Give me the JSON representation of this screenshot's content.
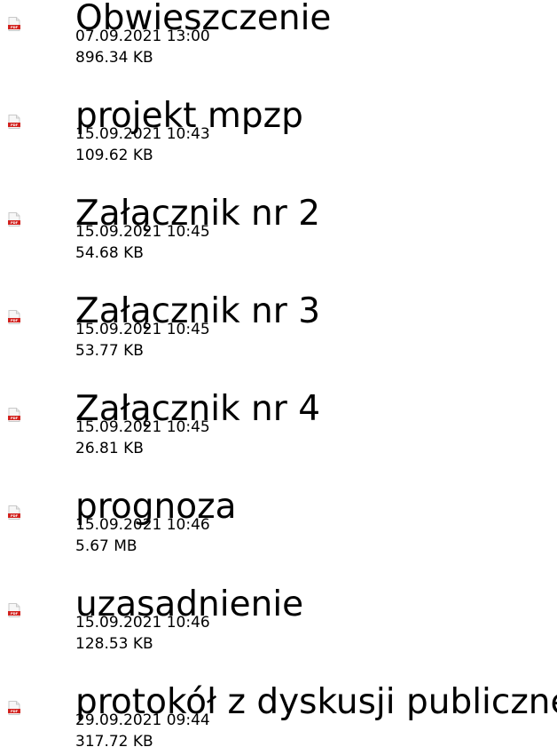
{
  "files": [
    {
      "name": "Obwieszczenie",
      "date": "07.09.2021 13:00",
      "size": "896.34 KB",
      "icon": "pdf-file-icon",
      "icon_label": "PDF"
    },
    {
      "name": "projekt mpzp",
      "date": "15.09.2021 10:43",
      "size": "109.62 KB",
      "icon": "pdf-file-icon",
      "icon_label": "PDF"
    },
    {
      "name": "Załącznik nr 2",
      "date": "15.09.2021 10:45",
      "size": "54.68 KB",
      "icon": "pdf-file-icon",
      "icon_label": "PDF"
    },
    {
      "name": "Załącznik nr 3",
      "date": "15.09.2021 10:45",
      "size": "53.77 KB",
      "icon": "pdf-file-icon",
      "icon_label": "PDF"
    },
    {
      "name": "Załącznik nr 4",
      "date": "15.09.2021 10:45",
      "size": "26.81 KB",
      "icon": "pdf-file-icon",
      "icon_label": "PDF"
    },
    {
      "name": "prognoza",
      "date": "15.09.2021 10:46",
      "size": "5.67 MB",
      "icon": "pdf-file-icon",
      "icon_label": "PDF"
    },
    {
      "name": "uzasadnienie",
      "date": "15.09.2021 10:46",
      "size": "128.53 KB",
      "icon": "pdf-file-icon",
      "icon_label": "PDF"
    },
    {
      "name": "protokół z dyskusji publicznej",
      "date": "29.09.2021 09:44",
      "size": "317.72 KB",
      "icon": "pdf-file-icon",
      "icon_label": "PDF"
    }
  ],
  "colors": {
    "pdf_badge": "#d2231f",
    "page": "#ffffff",
    "text": "#000000"
  }
}
